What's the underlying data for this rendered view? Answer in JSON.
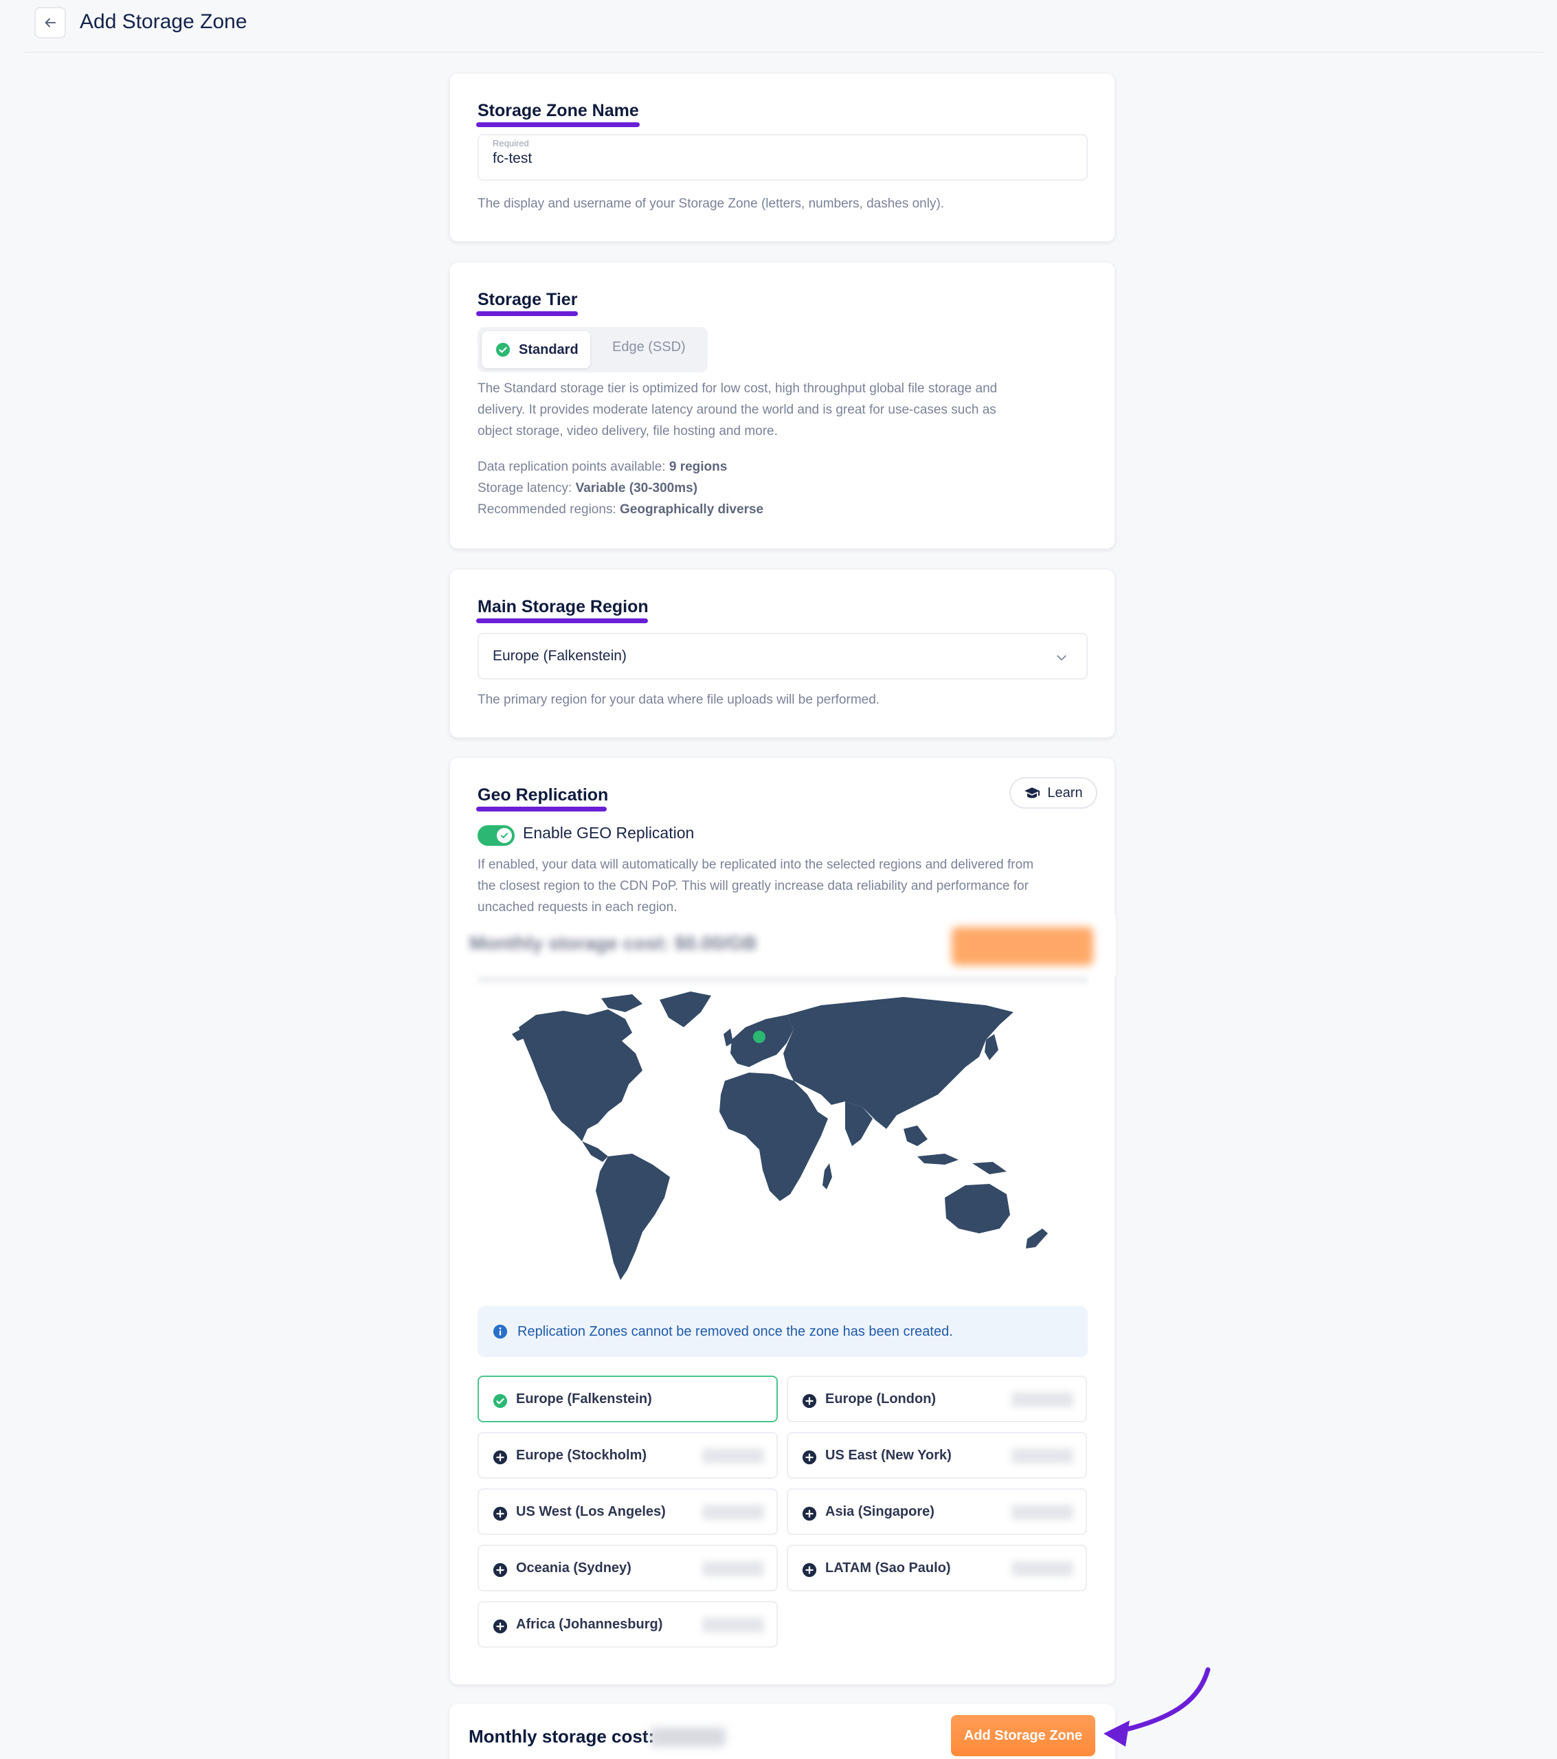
{
  "header": {
    "title": "Add Storage Zone"
  },
  "storage_zone_name": {
    "title": "Storage Zone Name",
    "field_label": "Required",
    "value": "fc-test",
    "help": "The display and username of your Storage Zone (letters, numbers, dashes only)."
  },
  "storage_tier": {
    "title": "Storage Tier",
    "options": {
      "active": "Standard",
      "inactive": "Edge (SSD)"
    },
    "description_line1": "The Standard storage tier is optimized for low cost, high throughput global file storage and",
    "description_line2": "delivery. It provides moderate latency around the world and is great for use-cases such as",
    "description_line3": "object storage, video delivery, file hosting and more.",
    "replication_label": "Data replication points available: ",
    "replication_value": "9 regions",
    "latency_label": "Storage latency: ",
    "latency_value": "Variable (30-300ms)",
    "recommended_label": "Recommended regions: ",
    "recommended_value": "Geographically diverse"
  },
  "main_region": {
    "title": "Main Storage Region",
    "selected": "Europe (Falkenstein)",
    "help": "The primary region for your data where file uploads will be performed."
  },
  "geo_replication": {
    "title": "Geo Replication",
    "learn_label": "Learn",
    "toggle_label": "Enable GEO Replication",
    "toggle_on": true,
    "description_line1": "If enabled, your data will automatically be replicated into the selected regions and delivered from",
    "description_line2": "the closest region to the CDN PoP. This will greatly increase data reliability and performance for",
    "description_line3": "uncached requests in each region.",
    "blurred_bar_text": "Monthly storage cost: $0.00/GB",
    "info": "Replication Zones cannot be removed once the zone has been created.",
    "regions": [
      {
        "label": "Europe (Falkenstein)",
        "selected": true
      },
      {
        "label": "Europe (London)",
        "selected": false
      },
      {
        "label": "Europe (Stockholm)",
        "selected": false
      },
      {
        "label": "US East (New York)",
        "selected": false
      },
      {
        "label": "US West (Los Angeles)",
        "selected": false
      },
      {
        "label": "Asia (Singapore)",
        "selected": false
      },
      {
        "label": "Oceania (Sydney)",
        "selected": false
      },
      {
        "label": "LATAM (Sao Paulo)",
        "selected": false
      },
      {
        "label": "Africa (Johannesburg)",
        "selected": false
      }
    ]
  },
  "footer": {
    "cost_label": "Monthly storage cost:",
    "add_button": "Add Storage Zone"
  },
  "colors": {
    "accent_underline": "#6a1fd6",
    "success_green": "#2cb873",
    "cta_orange": "#ff8b3a",
    "map_land": "#344a66",
    "info_blue": "#1e5aa8"
  }
}
